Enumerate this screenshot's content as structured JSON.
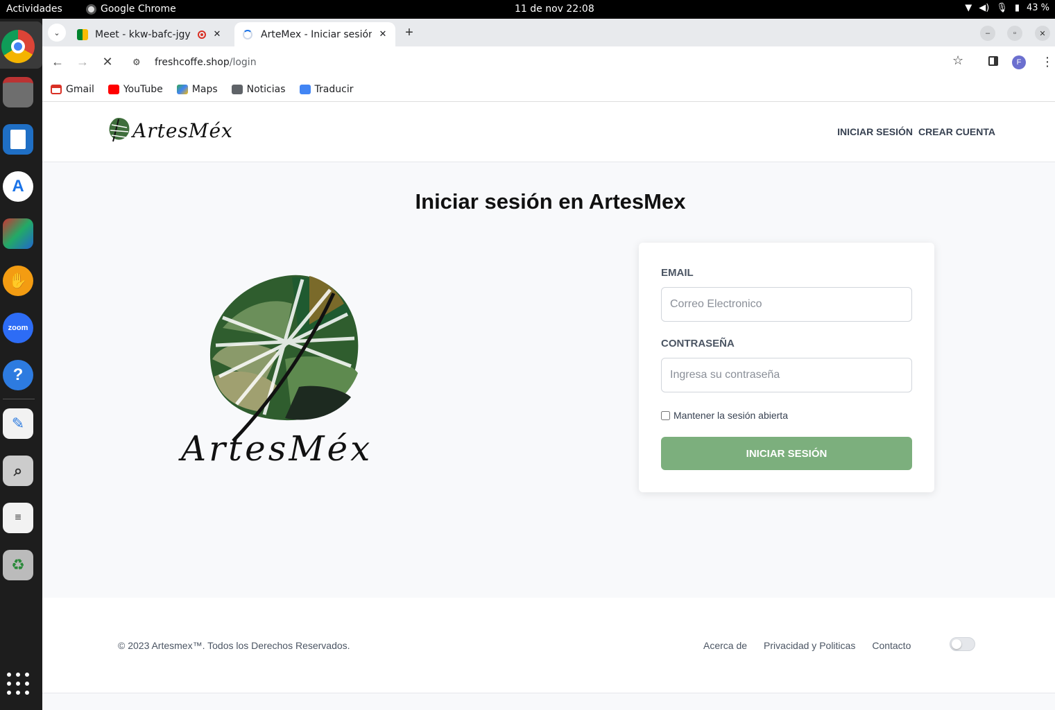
{
  "system": {
    "activities": "Actividades",
    "app_name": "Google Chrome",
    "clock": "11 de nov  22:08",
    "battery": "43 %"
  },
  "dock": {
    "items": [
      "chrome-icon",
      "files-icon",
      "writer-icon",
      "app-center-icon",
      "virtualbox-icon",
      "hand-app-icon",
      "zoom-icon",
      "help-icon",
      "text-editor-icon",
      "image-viewer-icon",
      "document-viewer-icon",
      "trash-icon"
    ],
    "zoom_label": "zoom",
    "help_label": "?"
  },
  "browser": {
    "tabs": [
      {
        "title": "Meet - kkw-bafc-jgy",
        "recording": true
      },
      {
        "title": "ArteMex - Iniciar sesión en ArtesMex",
        "loading": true
      }
    ],
    "url_host": "freshcoffe.shop",
    "url_path": "/login",
    "profile_initial": "F",
    "bookmarks": [
      "Gmail",
      "YouTube",
      "Maps",
      "Noticias",
      "Traducir"
    ]
  },
  "site": {
    "brand": "ArtesMéx",
    "nav": {
      "login": "INICIAR SESIÓN",
      "register": "CREAR CUENTA"
    },
    "page_title": "Iniciar sesión en ArtesMex",
    "form": {
      "email_label": "EMAIL",
      "email_placeholder": "Correo Electronico",
      "password_label": "CONTRASEÑA",
      "password_placeholder": "Ingresa su contraseña",
      "remember_label": "Mantener la sesión abierta",
      "remember_checked": false,
      "submit_label": "INICIAR SESIÓN"
    },
    "footer": {
      "copyright": "© 2023 Artesmex™. Todos los Derechos Reservados.",
      "links": [
        "Acerca de",
        "Privacidad y Politicas",
        "Contacto"
      ],
      "theme_toggle_on": false
    }
  },
  "colors": {
    "accent_green": "#7caf7d",
    "chrome_tab_bg": "#e8eaed"
  }
}
